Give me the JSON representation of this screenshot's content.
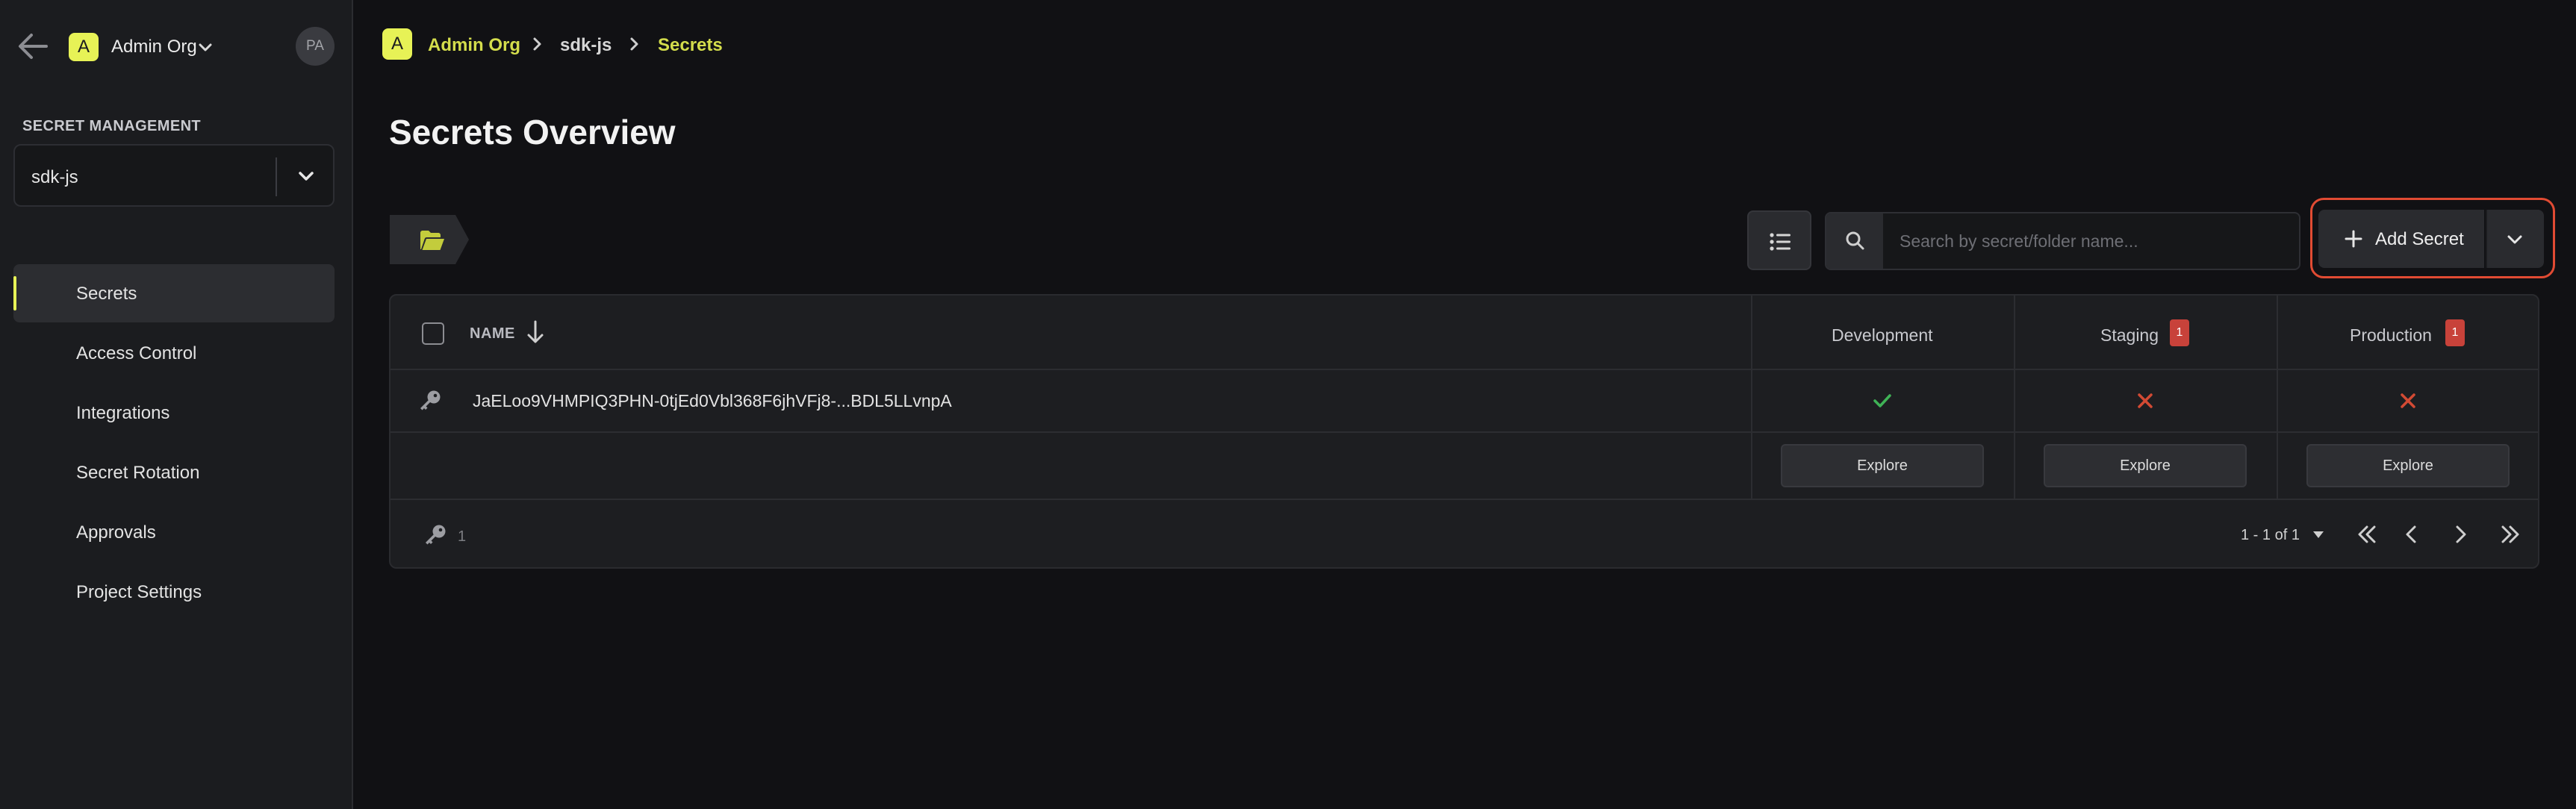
{
  "sidebar": {
    "org_initial": "A",
    "org_name": "Admin Org",
    "user_initials": "PA",
    "section_label": "SECRET MANAGEMENT",
    "project": "sdk-js",
    "items": [
      {
        "label": "Secrets",
        "active": true
      },
      {
        "label": "Access Control"
      },
      {
        "label": "Integrations"
      },
      {
        "label": "Secret Rotation"
      },
      {
        "label": "Approvals"
      },
      {
        "label": "Project Settings"
      }
    ]
  },
  "breadcrumb": {
    "org_initial": "A",
    "org": "Admin Org",
    "project": "sdk-js",
    "page": "Secrets"
  },
  "page": {
    "title": "Secrets Overview"
  },
  "toolbar": {
    "search_placeholder": "Search by secret/folder name...",
    "add_secret_label": "Add Secret"
  },
  "table": {
    "name_header": "NAME",
    "environments": [
      {
        "name": "Development",
        "missing_count": null
      },
      {
        "name": "Staging",
        "missing_count": "1"
      },
      {
        "name": "Production",
        "missing_count": "1"
      }
    ],
    "rows": [
      {
        "name": "JaELoo9VHMPIQ3PHN-0tjEd0Vbl368F6jhVFj8-...BDL5LLvnpA",
        "status": [
          "present",
          "missing",
          "missing"
        ]
      }
    ],
    "explore_label": "Explore",
    "footer": {
      "secret_count": "1",
      "pagination_text": "1 - 1 of 1"
    }
  },
  "colors": {
    "accent": "#e7f256",
    "success": "#3fb356",
    "danger": "#d24a34",
    "highlight": "#e14b33"
  }
}
